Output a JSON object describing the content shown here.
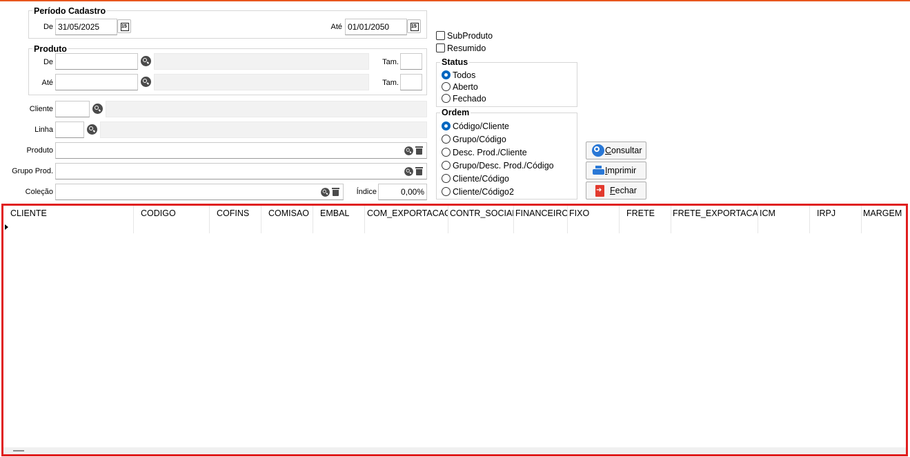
{
  "periodo": {
    "title": "Período Cadastro",
    "de_label": "De",
    "de_value": "31/05/2025",
    "ate_label": "Até",
    "ate_value": "01/01/2050"
  },
  "produto_group": {
    "title": "Produto",
    "de_label": "De",
    "ate_label": "Até",
    "tam_label": "Tam."
  },
  "filters": {
    "cliente_label": "Cliente",
    "linha_label": "Linha",
    "produto_label": "Produto",
    "grupo_label": "Grupo Prod.",
    "colecao_label": "Coleção",
    "indice_label": "Índice",
    "indice_value": "0,00%"
  },
  "options": {
    "subproduto": "SubProduto",
    "resumido": "Resumido"
  },
  "status": {
    "title": "Status",
    "items": [
      "Todos",
      "Aberto",
      "Fechado"
    ],
    "selected": "Todos"
  },
  "ordem": {
    "title": "Ordem",
    "items": [
      "Código/Cliente",
      "Grupo/Código",
      "Desc. Prod./Cliente",
      "Grupo/Desc. Prod./Código",
      "Cliente/Código",
      "Cliente/Código2"
    ],
    "selected": "Código/Cliente"
  },
  "buttons": {
    "consultar": {
      "accel": "C",
      "rest": "onsultar"
    },
    "imprimir": {
      "accel": "I",
      "rest": "mprimir"
    },
    "fechar": {
      "accel": "F",
      "rest": "echar"
    }
  },
  "grid": {
    "columns": [
      "CLIENTE",
      "CODIGO",
      "COFINS",
      "COMISAO",
      "EMBAL",
      "COM_EXPORTACAO",
      "CONTR_SOCIAL",
      "FINANCEIRO",
      "FIXO",
      "FRETE",
      "FRETE_EXPORTACAO",
      "ICM",
      "IRPJ",
      "MARGEM"
    ]
  },
  "colors": {
    "window_accent": "#e8571e",
    "grid_border": "#e01e1e",
    "radio_selected": "#0067c0",
    "button_icon_blue": "#2a78d6",
    "button_icon_red": "#e23a2e"
  },
  "icons": [
    "calendar-icon",
    "magnifier-icon",
    "trash-icon",
    "search-icon",
    "printer-icon",
    "exit-icon"
  ]
}
